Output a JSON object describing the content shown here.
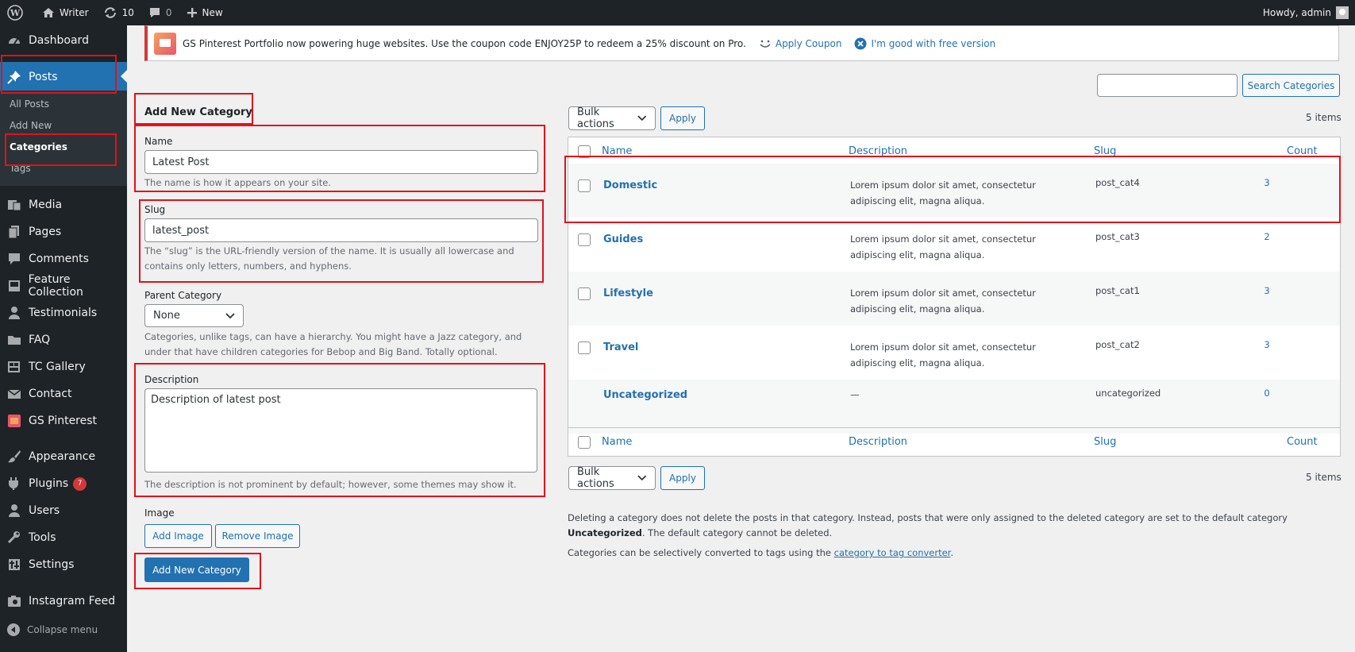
{
  "adminbar": {
    "site_name": "Writer",
    "updates_count": "10",
    "comments_count": "0",
    "new_label": "New",
    "howdy": "Howdy, admin"
  },
  "sidebar": {
    "dashboard": "Dashboard",
    "posts": "Posts",
    "submenu": [
      "All Posts",
      "Add New",
      "Categories",
      "Tags"
    ],
    "media": "Media",
    "pages": "Pages",
    "comments": "Comments",
    "feature_collection": "Feature Collection",
    "testimonials": "Testimonials",
    "faq": "FAQ",
    "tc_gallery": "TC Gallery",
    "contact": "Contact",
    "gs_pinterest": "GS Pinterest",
    "appearance": "Appearance",
    "plugins": "Plugins",
    "plugins_badge": "7",
    "users": "Users",
    "tools": "Tools",
    "settings": "Settings",
    "instagram_feed": "Instagram Feed",
    "collapse": "Collapse menu"
  },
  "notice": {
    "text": "GS Pinterest Portfolio now powering huge websites. Use the coupon code ENJOY25P to redeem a 25% discount on Pro.",
    "apply_coupon": "Apply Coupon",
    "dismiss": "I'm good with free version"
  },
  "search": {
    "value": "",
    "button": "Search Categories"
  },
  "form": {
    "heading": "Add New Category",
    "name_label": "Name",
    "name_value": "Latest Post",
    "name_help": "The name is how it appears on your site.",
    "slug_label": "Slug",
    "slug_value": "latest_post",
    "slug_help_1": "The “slug” is the URL-friendly version of the name. It is usually all lowercase and",
    "slug_help_2": "contains only letters, numbers, and hyphens.",
    "parent_label": "Parent Category",
    "parent_value": "None",
    "parent_help_1": "Categories, unlike tags, can have a hierarchy. You might have a Jazz category, and",
    "parent_help_2": "under that have children categories for Bebop and Big Band. Totally optional.",
    "description_label": "Description",
    "description_value": "Description of latest post",
    "description_help": "The description is not prominent by default; however, some themes may show it.",
    "image_label": "Image",
    "add_image": "Add Image",
    "remove_image": "Remove Image",
    "submit": "Add New Category"
  },
  "bulk": {
    "select": "Bulk actions",
    "apply": "Apply",
    "items": "5 items"
  },
  "table": {
    "headers": {
      "name": "Name",
      "description": "Description",
      "slug": "Slug",
      "count": "Count"
    },
    "rows": [
      {
        "name": "Domestic",
        "desc1": "Lorem ipsum dolor sit amet, consectetur",
        "desc2": "adipiscing elit, magna aliqua.",
        "slug": "post_cat4",
        "count": "3"
      },
      {
        "name": "Guides",
        "desc1": "Lorem ipsum dolor sit amet, consectetur",
        "desc2": "adipiscing elit, magna aliqua.",
        "slug": "post_cat3",
        "count": "2"
      },
      {
        "name": "Lifestyle",
        "desc1": "Lorem ipsum dolor sit amet, consectetur",
        "desc2": "adipiscing elit, magna aliqua.",
        "slug": "post_cat1",
        "count": "3"
      },
      {
        "name": "Travel",
        "desc1": "Lorem ipsum dolor sit amet, consectetur",
        "desc2": "adipiscing elit, magna aliqua.",
        "slug": "post_cat2",
        "count": "3"
      },
      {
        "name": "Uncategorized",
        "desc1": "—",
        "desc2": "",
        "slug": "uncategorized",
        "count": "0"
      }
    ]
  },
  "footnotes": {
    "line1": "Deleting a category does not delete the posts in that category. Instead, posts that were only assigned to the deleted category are set to the default category",
    "line2_bold": "Uncategorized",
    "line2_rest": ". The default category cannot be deleted.",
    "line3_pre": "Categories can be selectively converted to tags using the ",
    "line3_link": "category to tag converter",
    "line3_post": "."
  },
  "colors": {
    "admin_bar": "#1d2327",
    "accent": "#2271b1",
    "annotation_red": "#e3111b"
  }
}
